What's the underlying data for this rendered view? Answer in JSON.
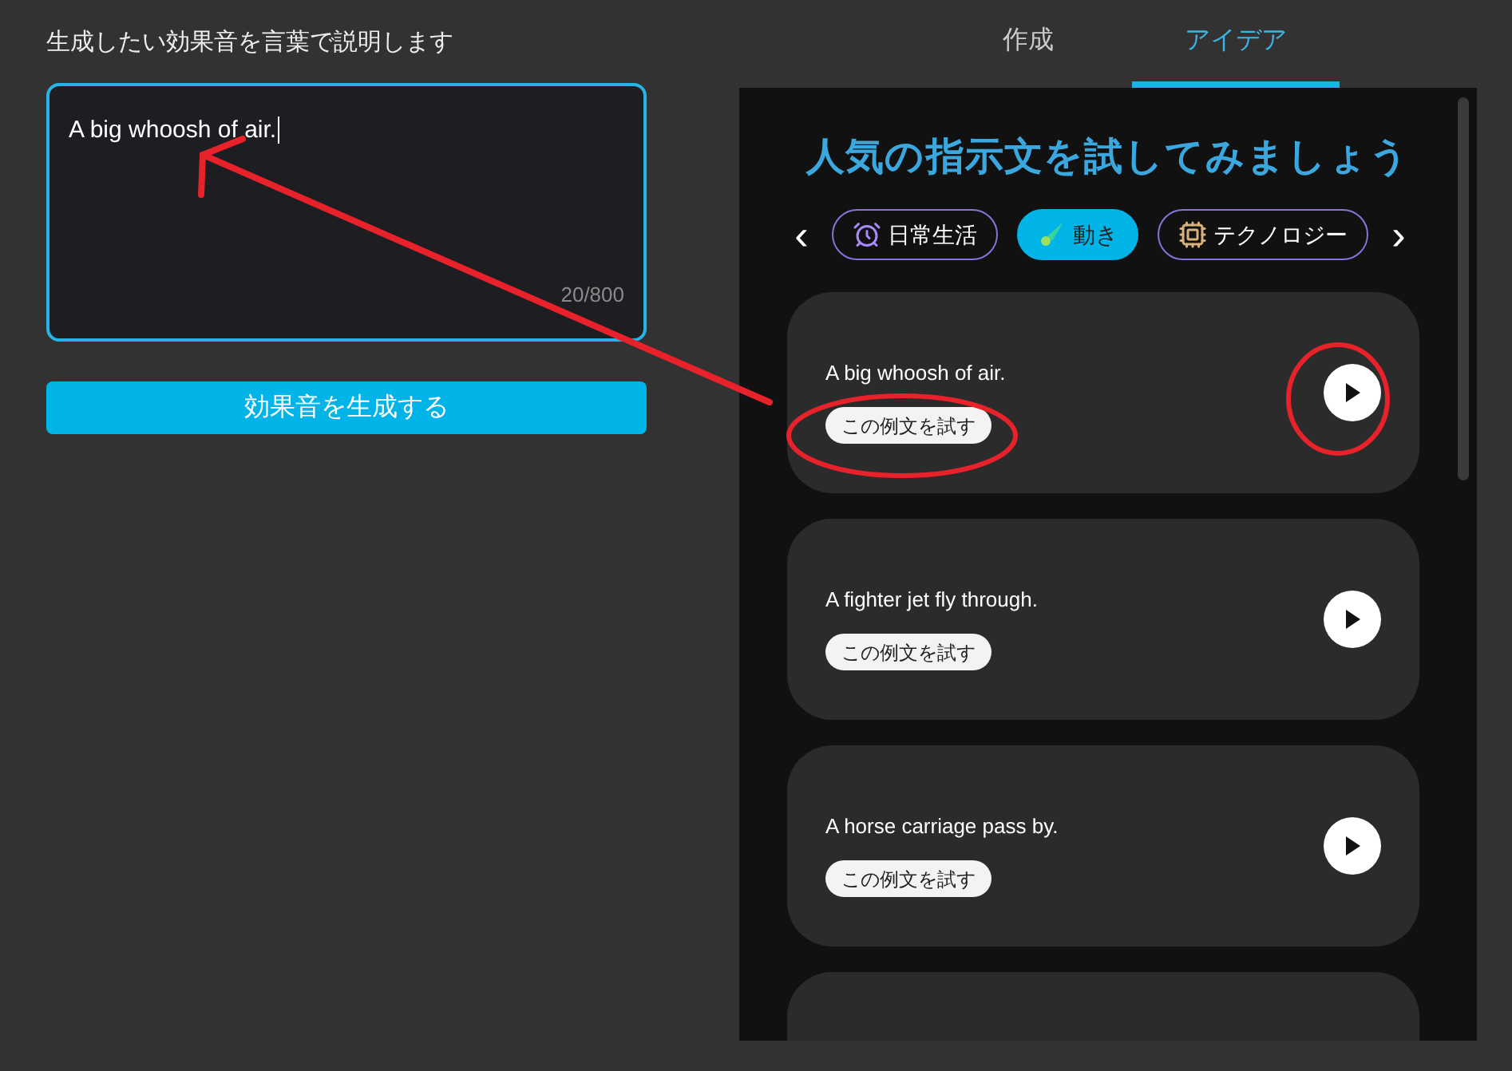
{
  "prompt_label": "生成したい効果音を言葉で説明します",
  "prompt_field": {
    "value": "A big whoosh of air.",
    "counter": "20/800"
  },
  "generate_button": "効果音を生成する",
  "tabs": [
    {
      "label": "作成",
      "selected": false
    },
    {
      "label": "アイデア",
      "selected": true
    }
  ],
  "ideas": {
    "title": "人気の指示文を試してみましょう",
    "prev": "‹",
    "next": "›",
    "categories": [
      {
        "label": "日常生活",
        "kind": "clock",
        "selected": false
      },
      {
        "label": "動き",
        "kind": "comet",
        "selected": true
      },
      {
        "label": "テクノロジー",
        "kind": "chip",
        "selected": false
      }
    ],
    "examples": [
      {
        "text": "A big whoosh of air.",
        "try_label": "この例文を試す"
      },
      {
        "text": "A fighter jet fly through.",
        "try_label": "この例文を試す"
      },
      {
        "text": "A horse carriage pass by.",
        "try_label": "この例文を試す"
      }
    ]
  }
}
